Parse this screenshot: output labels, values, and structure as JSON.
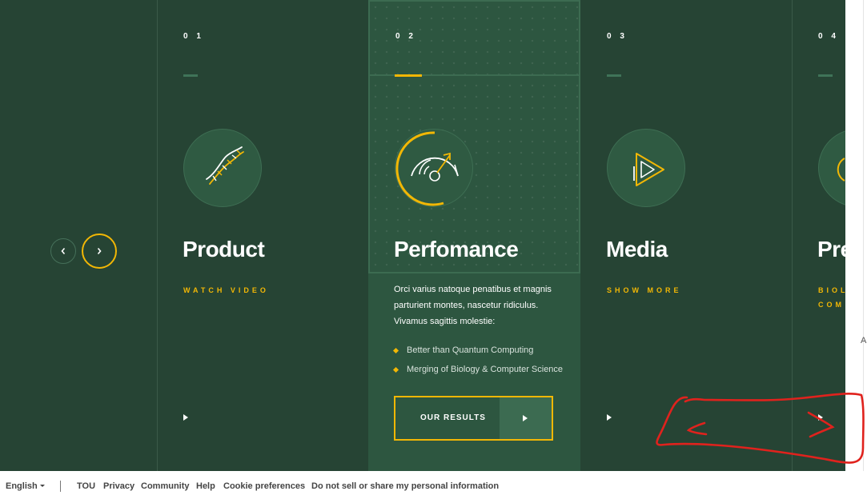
{
  "colors": {
    "background": "#264434",
    "active_column": "#2d5640",
    "accent": "#f2b705",
    "annotation": "#e0221d"
  },
  "slider": {
    "prev_icon": "chevron-left-icon",
    "next_icon": "chevron-right-icon",
    "columns": [
      {
        "number": "0 1",
        "title": "Product",
        "link": "WATCH VIDEO",
        "icon": "dna-icon"
      },
      {
        "number": "0 2",
        "title": "Perfomance",
        "icon": "speedometer-icon",
        "description": "Orci varius natoque penatibus et magnis parturient montes, nascetur ridiculus. Vivamus sagittis molestie:",
        "bullets": [
          "Better than Quantum Computing",
          "Merging of Biology & Computer Science"
        ],
        "button": "OUR RESULTS"
      },
      {
        "number": "0 3",
        "title": "Media",
        "link": "SHOW MORE",
        "icon": "play-icon"
      },
      {
        "number": "0 4",
        "title": "Pre",
        "link_line1": "BIOL",
        "link_line2": "COM",
        "icon": "partial-icon"
      }
    ]
  },
  "stray_text": "A",
  "footer": {
    "language": "English",
    "links": [
      "TOU",
      "Privacy",
      "Community",
      "Help",
      "Cookie preferences",
      "Do not sell or share my personal information"
    ]
  }
}
